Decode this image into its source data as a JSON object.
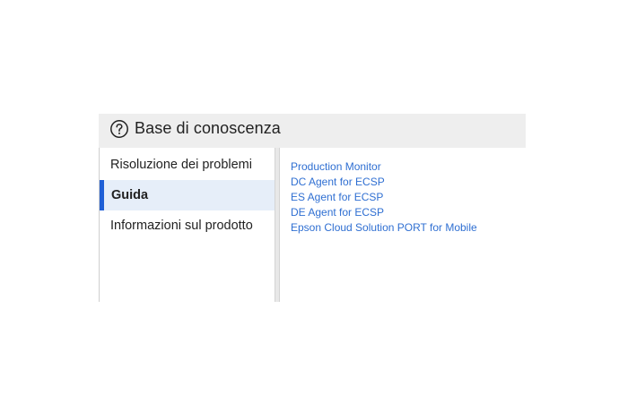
{
  "header": {
    "icon": "help-circle-icon",
    "title": "Base di conoscenza"
  },
  "sidebar": {
    "items": [
      {
        "label": "Risoluzione dei problemi",
        "active": false
      },
      {
        "label": "Guida",
        "active": true
      },
      {
        "label": "Informazioni sul prodotto",
        "active": false
      }
    ]
  },
  "content": {
    "links": [
      "Production Monitor",
      "DC Agent for ECSP",
      "ES Agent for ECSP",
      "DE Agent for ECSP",
      "Epson Cloud Solution PORT for Mobile"
    ]
  },
  "colors": {
    "accent": "#1f5fd6",
    "link": "#2f6fd2",
    "active_bg": "#e6eef9",
    "header_bg": "#eeeeee"
  }
}
